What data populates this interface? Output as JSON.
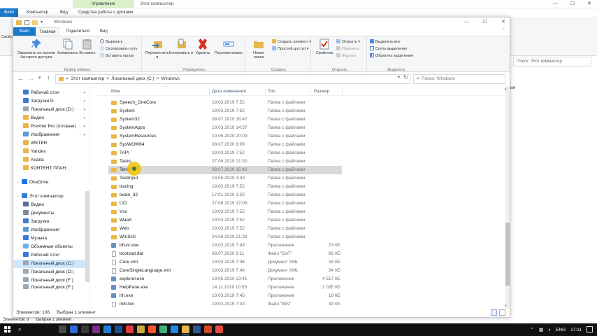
{
  "background_window": {
    "context_tab": "Управление",
    "title": "Этот компьютер",
    "tabs": {
      "file": "Файл",
      "computer": "Компьютер",
      "view": "Вид",
      "disk_tools": "Средства работы с дисками"
    },
    "ribbon_left_label": "Свойс",
    "search_placeholder": "Поиск: Этот компьютер",
    "right_edge_text": "ия",
    "status_items": "Элементов: 9",
    "status_selected": "Выбран 1 элемент"
  },
  "window": {
    "title": "Windows",
    "tabs": {
      "file": "Файл",
      "home": "Главная",
      "share": "Поделиться",
      "view": "Вид"
    }
  },
  "ribbon": {
    "clipboard": {
      "label": "Буфер обмена",
      "pin_quick": "Закрепить на панели быстрого доступа",
      "copy": "Копировать",
      "paste": "Вставить",
      "cut": "Вырезать",
      "copy_path": "Скопировать путь",
      "paste_shortcut": "Вставить ярлык"
    },
    "organize": {
      "label": "Упорядочить",
      "move_to": "Переместить в",
      "copy_to": "Копировать в",
      "delete": "Удалить",
      "rename": "Переименовать"
    },
    "new": {
      "label": "Создать",
      "new_folder": "Новая папка",
      "new_item": "Создать элемент",
      "easy_access": "Простой доступ"
    },
    "open": {
      "label": "Открыть",
      "properties": "Свойства",
      "open": "Открыть",
      "edit": "Изменить",
      "history": "Журнал"
    },
    "select": {
      "label": "Выделить",
      "select_all": "Выделить все",
      "select_none": "Снять выделение",
      "invert": "Обратить выделение"
    }
  },
  "address": {
    "path": [
      "Этот компьютер",
      "Локальный диск (C:)",
      "Windows"
    ],
    "sep": ">",
    "search_placeholder": "Поиск: Windows"
  },
  "nav": {
    "items": [
      {
        "label": "Рабочий стол",
        "icon": "desktop-icon",
        "pinned": true
      },
      {
        "label": "Загрузки D",
        "icon": "download-icon",
        "pinned": true
      },
      {
        "label": "Локальный диск (D:)",
        "icon": "drive-icon",
        "pinned": true
      },
      {
        "label": "Видео",
        "icon": "folder-icon",
        "pinned": true
      },
      {
        "label": "Premier Pro (готовые)",
        "icon": "folder-icon",
        "pinned": true
      },
      {
        "label": "Изображения",
        "icon": "pictures-icon",
        "pinned": true
      },
      {
        "label": "WETER",
        "icon": "folder-icon",
        "pinned": false
      },
      {
        "label": "Yandex",
        "icon": "folder-icon",
        "pinned": false
      },
      {
        "label": "Анапа",
        "icon": "folder-icon",
        "pinned": false
      },
      {
        "label": "КОНТЕНТ ПЛАН",
        "icon": "folder-icon",
        "pinned": false
      },
      {
        "label": "OneDrive",
        "icon": "cloud-icon",
        "pinned": false
      },
      {
        "label": "Этот компьютер",
        "icon": "computer-icon",
        "pinned": false
      },
      {
        "label": "Видео",
        "icon": "video-icon",
        "pinned": false
      },
      {
        "label": "Документы",
        "icon": "documents-icon",
        "pinned": false
      },
      {
        "label": "Загрузки",
        "icon": "download-icon",
        "pinned": false
      },
      {
        "label": "Изображения",
        "icon": "pictures-icon",
        "pinned": false
      },
      {
        "label": "Музыка",
        "icon": "music-icon",
        "pinned": false
      },
      {
        "label": "Объемные объекты",
        "icon": "3d-objects-icon",
        "pinned": false
      },
      {
        "label": "Рабочий стол",
        "icon": "desktop-icon",
        "pinned": false
      },
      {
        "label": "Локальный диск (C:)",
        "icon": "drive-icon",
        "pinned": false
      },
      {
        "label": "Локальный диск (D:)",
        "icon": "drive-icon",
        "pinned": false
      },
      {
        "label": "Локальный диск (F:)",
        "icon": "drive-icon",
        "pinned": false
      },
      {
        "label": "Локальный диск (F:)",
        "icon": "drive-icon",
        "pinned": false
      }
    ]
  },
  "columns": {
    "name": "Имя",
    "date": "Дата изменения",
    "type": "Тип",
    "size": "Размер"
  },
  "files": [
    {
      "name": "Speech_OneCore",
      "date": "19.03.2019 7:52",
      "type": "Папка с файлами",
      "size": "",
      "kind": "folder"
    },
    {
      "name": "System",
      "date": "19.03.2019 7:52",
      "type": "Папка с файлами",
      "size": "",
      "kind": "folder"
    },
    {
      "name": "System32",
      "date": "08.07.2020 16:47",
      "type": "Папка с файлами",
      "size": "",
      "kind": "folder"
    },
    {
      "name": "SystemApps",
      "date": "19.03.2019 14:37",
      "type": "Папка с файлами",
      "size": "",
      "kind": "folder"
    },
    {
      "name": "SystemResources",
      "date": "10.06.2020 20:03",
      "type": "Папка с файлами",
      "size": "",
      "kind": "folder"
    },
    {
      "name": "SysWOW64",
      "date": "08.07.2020 9:09",
      "type": "Папка с файлами",
      "size": "",
      "kind": "folder"
    },
    {
      "name": "TAPI",
      "date": "19.03.2019 7:52",
      "type": "Папка с файлами",
      "size": "",
      "kind": "folder"
    },
    {
      "name": "Tasks",
      "date": "27.08.2019 21:30",
      "type": "Папка с файлами",
      "size": "",
      "kind": "folder"
    },
    {
      "name": "Temp",
      "date": "08.07.2020 15:42",
      "type": "Папка с файлами",
      "size": "",
      "kind": "folder"
    },
    {
      "name": "TextInput",
      "date": "14.05.2020 1:43",
      "type": "Папка с файлами",
      "size": "",
      "kind": "folder"
    },
    {
      "name": "tracing",
      "date": "19.03.2019 7:52",
      "type": "Папка с файлами",
      "size": "",
      "kind": "folder"
    },
    {
      "name": "twain_32",
      "date": "17.01.2020 1:20",
      "type": "Папка с файлами",
      "size": "",
      "kind": "folder"
    },
    {
      "name": "UCI",
      "date": "27.08.2019 17:09",
      "type": "Папка с файлами",
      "size": "",
      "kind": "folder"
    },
    {
      "name": "Vss",
      "date": "19.03.2019 7:52",
      "type": "Папка с файлами",
      "size": "",
      "kind": "folder"
    },
    {
      "name": "WaaS",
      "date": "19.03.2019 7:52",
      "type": "Папка с файлами",
      "size": "",
      "kind": "folder"
    },
    {
      "name": "Web",
      "date": "19.03.2019 7:52",
      "type": "Папка с файлами",
      "size": "",
      "kind": "folder"
    },
    {
      "name": "WinSxS",
      "date": "24.06.2020 21:38",
      "type": "Папка с файлами",
      "size": "",
      "kind": "folder"
    },
    {
      "name": "bfsvc.exe",
      "date": "19.03.2019 7:43",
      "type": "Приложение",
      "size": "73 КБ",
      "kind": "exe"
    },
    {
      "name": "bootstat.dat",
      "date": "08.07.2020 9:11",
      "type": "Файл \"DAT\"",
      "size": "66 КБ",
      "kind": "file"
    },
    {
      "name": "Core.xml",
      "date": "19.03.2019 7:46",
      "type": "Документ XML",
      "size": "34 КБ",
      "kind": "file"
    },
    {
      "name": "CoreSingleLanguage.xml",
      "date": "19.03.2019 7:46",
      "type": "Документ XML",
      "size": "34 КБ",
      "kind": "file"
    },
    {
      "name": "explorer.exe",
      "date": "13.05.2020 23:41",
      "type": "Приложение",
      "size": "4 517 КБ",
      "kind": "exe"
    },
    {
      "name": "HelpPane.exe",
      "date": "14.11.2019 10:53",
      "type": "Приложение",
      "size": "1 035 КБ",
      "kind": "exe"
    },
    {
      "name": "hh.exe",
      "date": "19.03.2019 7:45",
      "type": "Приложение",
      "size": "18 КБ",
      "kind": "exe"
    },
    {
      "name": "mib.bin",
      "date": "19.03.2019 7:43",
      "type": "Файл \"BIN\"",
      "size": "43 КБ",
      "kind": "file"
    }
  ],
  "highlighted_index": 8,
  "status": {
    "count": "Элементов: 106",
    "selected": "Выбран 1 элемент"
  },
  "taskbar": {
    "lang": "ENG",
    "time": "17:11"
  },
  "colors": {
    "accent": "#1979ca",
    "folder": "#e8b74a",
    "selected": "#cce8ff",
    "hover": "#d9d9d9",
    "cursor": "#f2c200"
  }
}
